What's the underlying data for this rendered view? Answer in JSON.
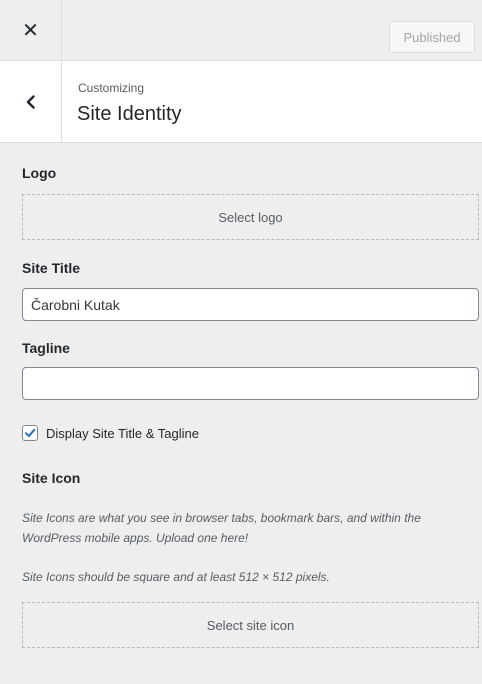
{
  "topbar": {
    "close_icon": "close-icon",
    "publish_label": "Published"
  },
  "header": {
    "back_icon": "chevron-left-icon",
    "eyebrow": "Customizing",
    "title": "Site Identity"
  },
  "logo": {
    "label": "Logo",
    "button_label": "Select logo"
  },
  "site_title": {
    "label": "Site Title",
    "value": "Čarobni Kutak"
  },
  "tagline": {
    "label": "Tagline",
    "value": ""
  },
  "display_title": {
    "checked": true,
    "label": "Display Site Title & Tagline"
  },
  "site_icon": {
    "label": "Site Icon",
    "description": "Site Icons are what you see in browser tabs, bookmark bars, and within the WordPress mobile apps. Upload one here!",
    "requirement": "Site Icons should be square and at least 512 × 512 pixels.",
    "button_label": "Select site icon"
  },
  "colors": {
    "accent": "#2271b1",
    "panel_bg": "#eeeeee",
    "header_bg": "#ffffff"
  }
}
